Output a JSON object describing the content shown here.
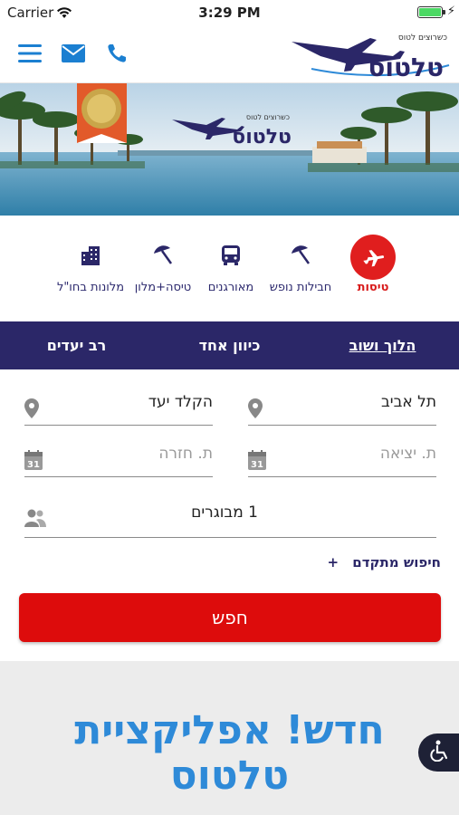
{
  "status_bar": {
    "carrier": "Carrier",
    "time": "3:29 PM",
    "battery_level": 1.0
  },
  "header": {
    "logo_text": "טלטוס",
    "logo_tagline": "כשרוצים לטוס",
    "icons": [
      "menu-icon",
      "mail-icon",
      "phone-icon"
    ]
  },
  "hero": {
    "logo_text": "טלטוס",
    "logo_tagline": "כשרוצים לטוס"
  },
  "categories": [
    {
      "label": "טיסות",
      "icon": "plane-icon",
      "active": true
    },
    {
      "label": "חבילות נופש",
      "icon": "beach-umbrella-icon",
      "active": false
    },
    {
      "label": "מאורגנים",
      "icon": "bus-icon",
      "active": false
    },
    {
      "label": "טיסה+מלון",
      "icon": "beach-umbrella-icon",
      "active": false
    },
    {
      "label": "מלונות בחו\"ל",
      "icon": "hotel-icon",
      "active": false
    }
  ],
  "trip_types": [
    {
      "label": "הלוך ושוב",
      "selected": true
    },
    {
      "label": "כיוון אחד",
      "selected": false
    },
    {
      "label": "רב יעדים",
      "selected": false
    }
  ],
  "form": {
    "origin": "תל אביב",
    "destination_placeholder": "הקלד יעד",
    "departure_placeholder": "ת. יציאה",
    "return_placeholder": "ת. חזרה",
    "passengers": "1 מבוגרים",
    "calendar_day": "31"
  },
  "advanced_search": {
    "plus": "+",
    "label": "חיפוש מתקדם"
  },
  "search_button": "חפש",
  "promo": {
    "line1": "חדש! אפליקציית",
    "line2": "טלטוס"
  },
  "colors": {
    "navy": "#2b2768",
    "red": "#dd0c0c",
    "promo_blue": "#2e8ad8"
  }
}
